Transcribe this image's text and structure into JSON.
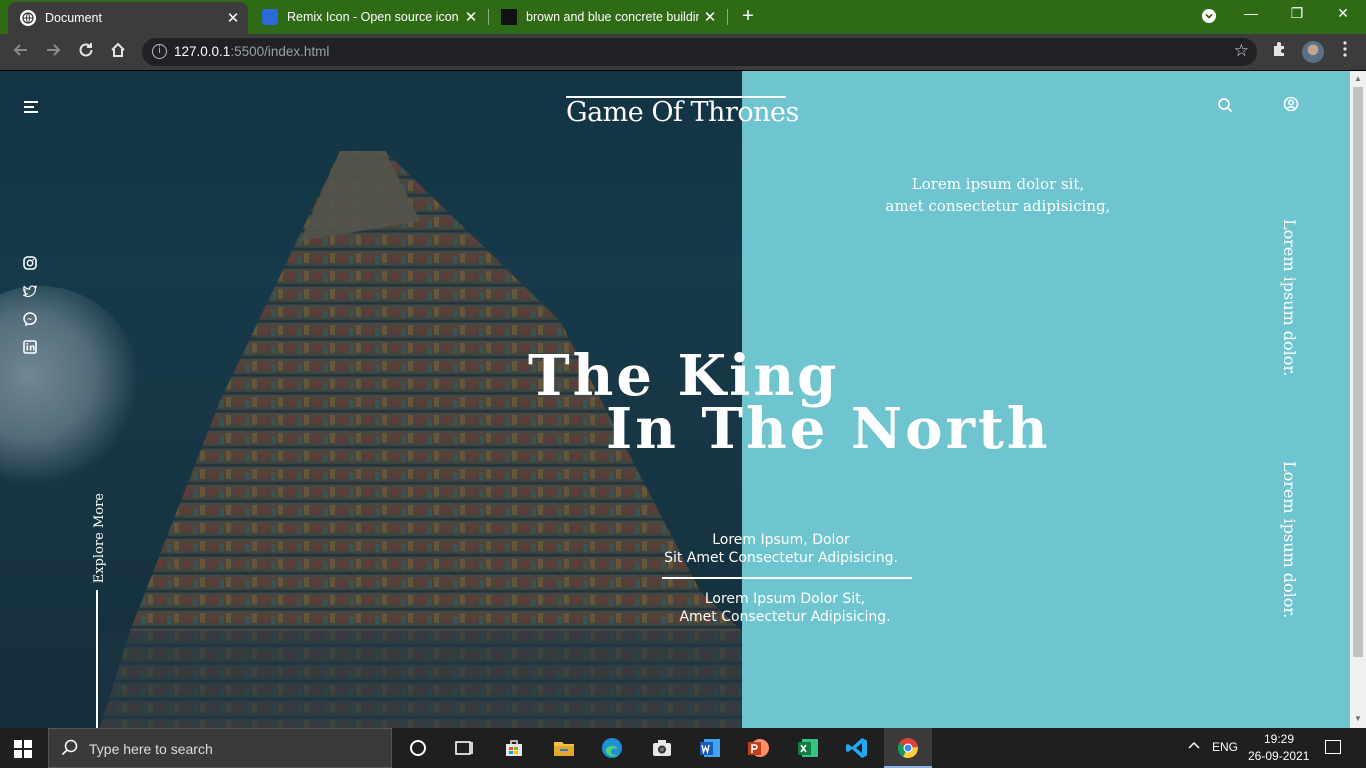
{
  "browser": {
    "tabs": [
      {
        "title": "Document",
        "active": true
      },
      {
        "title": "Remix Icon - Open source icon lib",
        "active": false
      },
      {
        "title": "brown and blue concrete building",
        "active": false
      }
    ],
    "close_glyph": "✕",
    "new_tab_glyph": "+",
    "window_controls": {
      "minimize": "—",
      "restore": "❐",
      "close": "✕"
    },
    "url_host": "127.0.0.1",
    "url_rest": ":5500/index.html",
    "info_glyph": "i",
    "star_glyph": "☆"
  },
  "page": {
    "brand": "Game Of Thrones",
    "right_quote_line1": "Lorem ipsum dolor sit,",
    "right_quote_line2": "amet consectetur adipisicing,",
    "vertical_text_1": "Lorem ipsum dolor.",
    "vertical_text_2": "Lorem ipsum dolor.",
    "hero_line1": "The King",
    "hero_line2": "In The North",
    "caption1_line1": "Lorem Ipsum, Dolor",
    "caption1_line2": "Sit Amet Consectetur Adipisicing.",
    "caption2_line1": "Lorem Ipsum Dolor Sit,",
    "caption2_line2": "Amet Consectetur Adipisicing.",
    "explore": "Explore More",
    "social_icons": [
      "instagram-icon",
      "twitter-icon",
      "messenger-icon",
      "linkedin-icon"
    ],
    "colors": {
      "accent_panel": "#6fc5cf",
      "photo_dark": "#1b4254",
      "text": "#ffffff"
    }
  },
  "taskbar": {
    "search_placeholder": "Type here to search",
    "language": "ENG",
    "time": "19:29",
    "date": "26-09-2021",
    "apps": [
      "cortana-icon",
      "task-view-icon",
      "store-icon",
      "file-explorer-icon",
      "edge-icon",
      "camera-icon",
      "word-icon",
      "powerpoint-icon",
      "excel-icon",
      "vscode-icon",
      "chrome-icon"
    ]
  }
}
